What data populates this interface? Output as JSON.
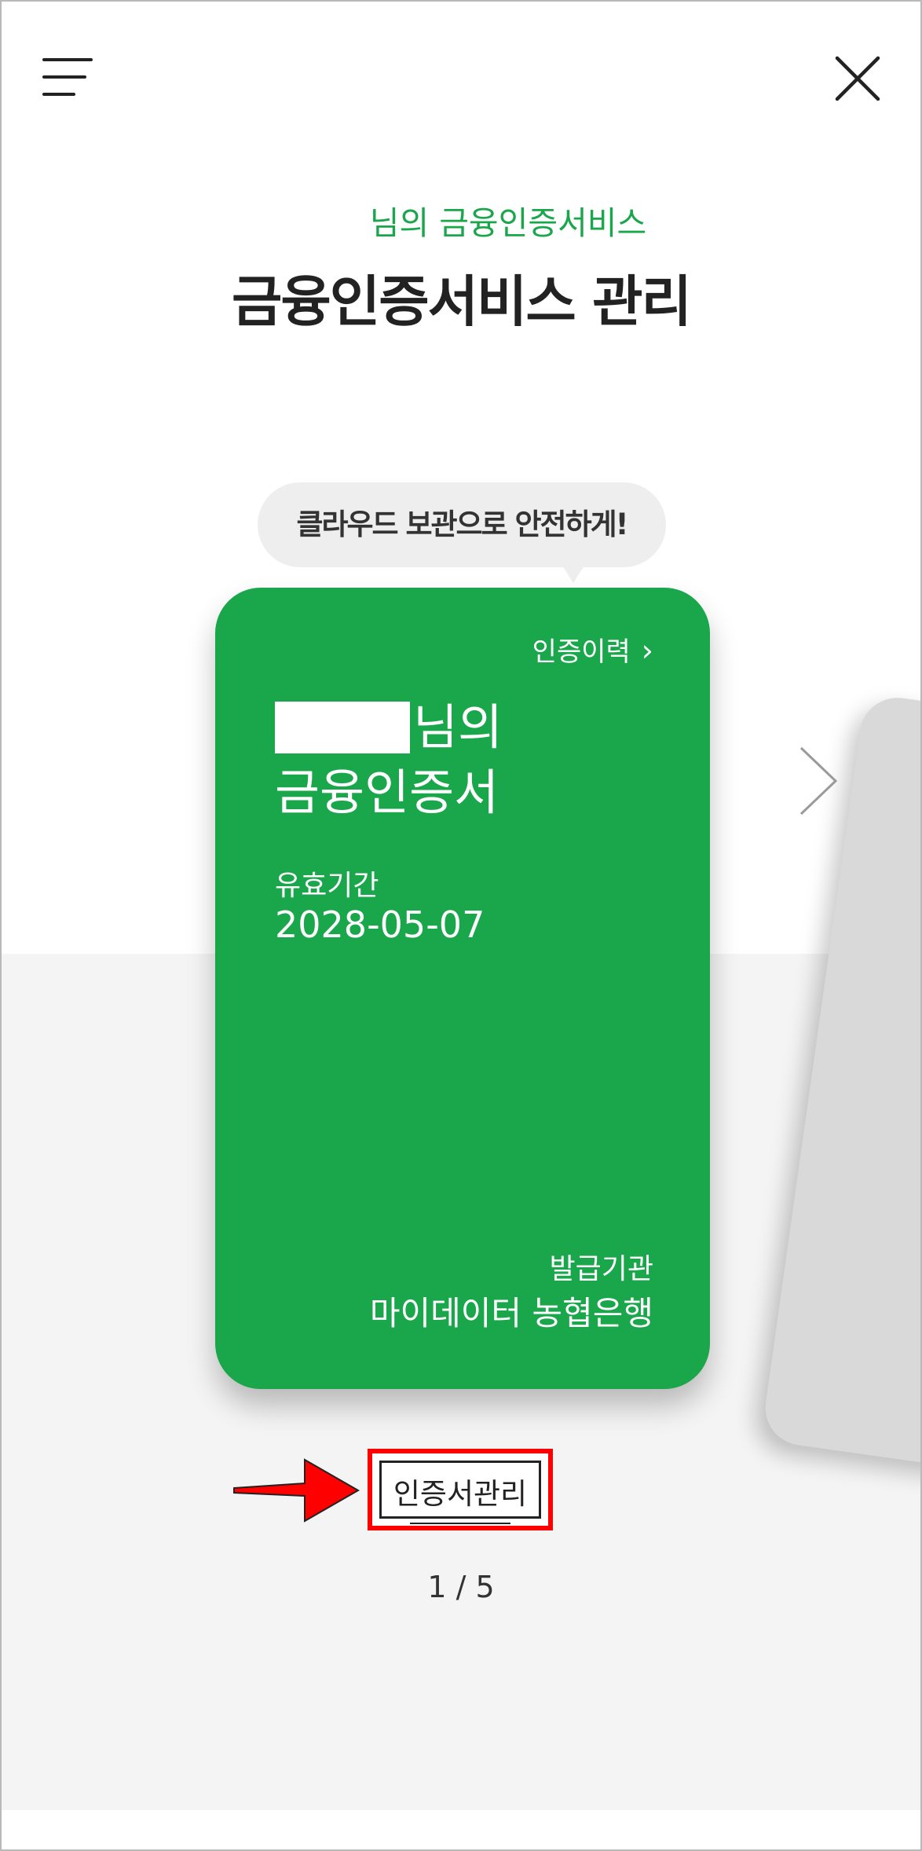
{
  "header": {
    "subtitle": "님의 금융인증서비스",
    "title": "금융인증서비스 관리"
  },
  "promo_bubble": "클라우드 보관으로 안전하게!",
  "certificate_card": {
    "history_link": "인증이력",
    "name_suffix": "님의",
    "cert_label": "금융인증서",
    "validity_label": "유효기간",
    "validity_date": "2028-05-07",
    "issuer_label": "발급기관",
    "issuer_name": "마이데이터 농협은행",
    "color": "#1aa64a"
  },
  "manage_button": "인증서관리",
  "pagination": "1 / 5",
  "icons": {
    "menu": "menu-icon",
    "close": "close-icon",
    "history_chevron": "chevron-right-icon",
    "next": "chevron-right-icon"
  },
  "colors": {
    "accent": "#1aa64a",
    "highlight": "#ff0000",
    "background_lower": "#f4f4f4"
  }
}
